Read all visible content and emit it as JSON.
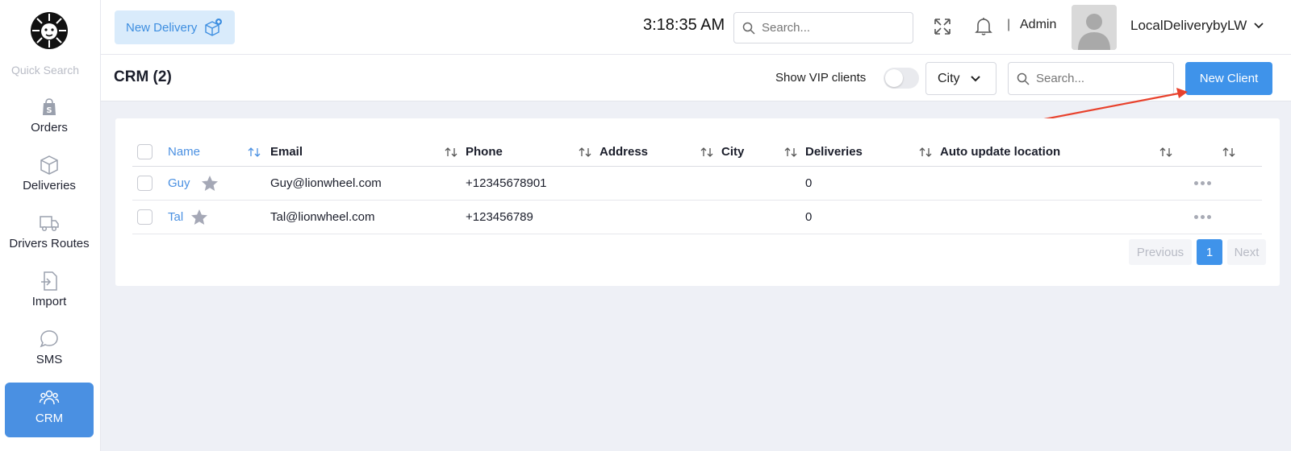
{
  "sidebar": {
    "quick_search": "Quick Search",
    "items": [
      {
        "label": "Orders",
        "icon": "shopify-bag-icon"
      },
      {
        "label": "Deliveries",
        "icon": "box-icon"
      },
      {
        "label": "Drivers Routes",
        "icon": "truck-icon"
      },
      {
        "label": "Import",
        "icon": "import-icon"
      },
      {
        "label": "SMS",
        "icon": "chat-bubble-icon"
      },
      {
        "label": "CRM",
        "icon": "users-icon",
        "active": true
      }
    ]
  },
  "topbar": {
    "new_delivery_label": "New Delivery",
    "clock": "3:18:35 AM",
    "search_placeholder": "Search...",
    "separator": "|",
    "role": "Admin",
    "account_name": "LocalDeliverybyLW"
  },
  "subheader": {
    "title": "CRM (2)",
    "vip_label": "Show VIP clients",
    "vip_enabled": false,
    "city_select": "City",
    "search_placeholder": "Search...",
    "new_client_label": "New Client"
  },
  "table": {
    "columns": [
      "Name",
      "Email",
      "Phone",
      "Address",
      "City",
      "Deliveries",
      "Auto update location"
    ],
    "rows": [
      {
        "name": "Guy",
        "email": "Guy@lionwheel.com",
        "phone": "+12345678901",
        "address": "",
        "city": "",
        "deliveries": "0",
        "auto_update": ""
      },
      {
        "name": "Tal",
        "email": "Tal@lionwheel.com",
        "phone": "+123456789",
        "address": "",
        "city": "",
        "deliveries": "0",
        "auto_update": ""
      }
    ]
  },
  "pagination": {
    "previous": "Previous",
    "current": "1",
    "next": "Next"
  },
  "colors": {
    "accent": "#3f93ea",
    "annotation_arrow": "#e8412c"
  }
}
